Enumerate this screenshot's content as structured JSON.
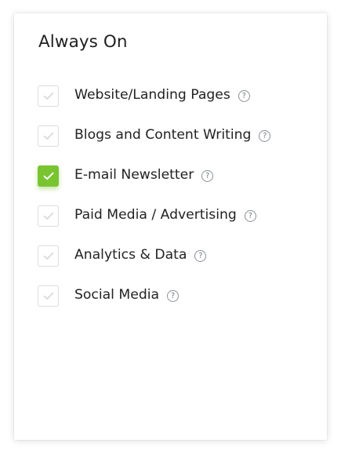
{
  "card": {
    "title": "Always On"
  },
  "options": [
    {
      "label": "Website/Landing Pages",
      "checked": false,
      "help_icon": "question-circle-icon",
      "help_glyph": "?"
    },
    {
      "label": "Blogs and Content Writing",
      "checked": false,
      "help_icon": "question-circle-icon",
      "help_glyph": "?"
    },
    {
      "label": "E-mail Newsletter",
      "checked": true,
      "help_icon": "question-circle-icon",
      "help_glyph": "?"
    },
    {
      "label": "Paid Media / Advertising",
      "checked": false,
      "help_icon": "question-circle-icon",
      "help_glyph": "?"
    },
    {
      "label": "Analytics & Data",
      "checked": false,
      "help_icon": "question-circle-icon",
      "help_glyph": "?"
    },
    {
      "label": "Social Media",
      "checked": false,
      "help_icon": "question-circle-icon",
      "help_glyph": "?"
    }
  ],
  "colors": {
    "checked_fill": "#79c431",
    "unchecked_border": "#d9dde2",
    "text": "#222222",
    "help_icon": "#8a8f96"
  },
  "icons": {
    "checkbox_mark": "checkmark-icon",
    "help": "question-circle-icon"
  }
}
